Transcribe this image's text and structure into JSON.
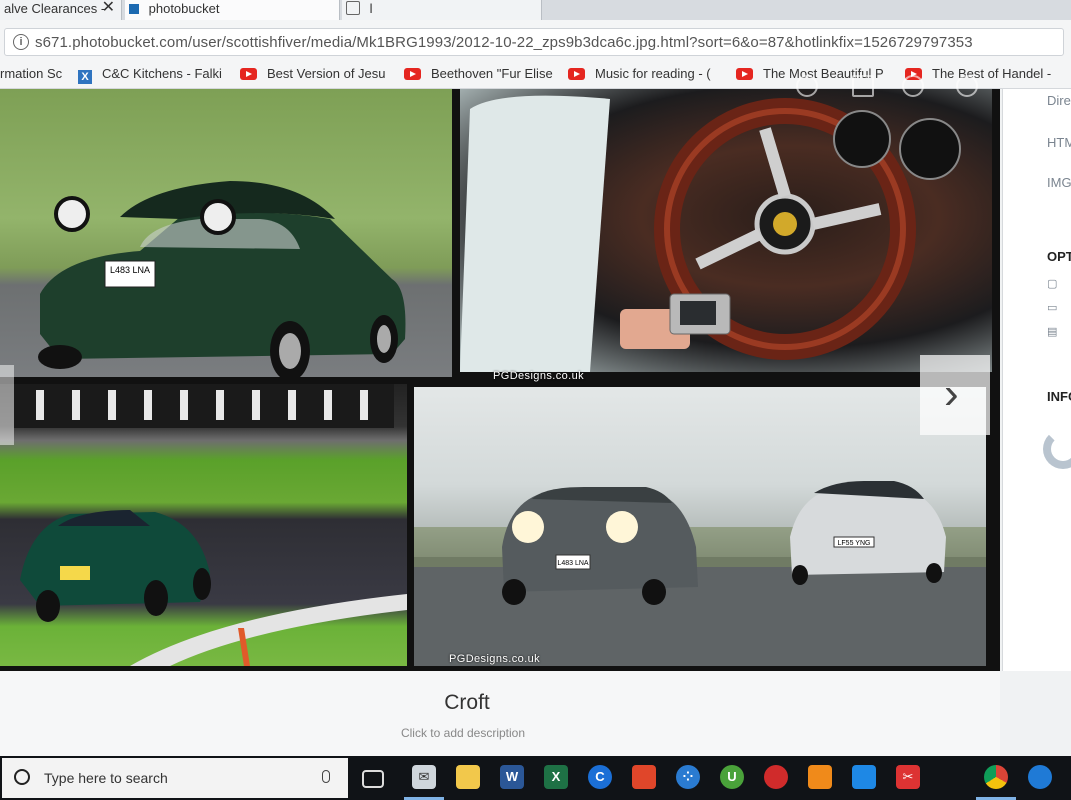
{
  "tabs": [
    {
      "label": "alve Clearances -",
      "close": "✕"
    },
    {
      "label": "photobucket"
    },
    {
      "label": "l"
    }
  ],
  "address": {
    "url": "s671.photobucket.com/user/scottishfiver/media/Mk1BRG1993/2012-10-22_zps9b3dca6c.jpg.html?sort=6&o=87&hotlinkfix=1526729797353"
  },
  "bookmarks": [
    {
      "label": "rmation Sc",
      "icon": "doc-icon"
    },
    {
      "label": "C&C Kitchens - Falki",
      "icon": "cc-icon"
    },
    {
      "label": "Best Version of Jesu",
      "icon": "youtube-icon"
    },
    {
      "label": "Beethoven \"Fur Elise",
      "icon": "youtube-icon"
    },
    {
      "label": "Music for reading - (",
      "icon": "youtube-icon"
    },
    {
      "label": "The Most Beautiful P",
      "icon": "youtube-icon"
    },
    {
      "label": "The Best of Handel -",
      "icon": "youtube-icon"
    }
  ],
  "photo": {
    "watermark_top": "PGDesigns.co.uk",
    "watermark_bottom": "PGDesigns.co.uk",
    "plate_green": "L483 LNA",
    "plate_silver": "LF55 YNG",
    "next_arrow": "›"
  },
  "side": {
    "links": [
      "Dire",
      "HTM",
      "IMG"
    ],
    "options_head": "OPT",
    "info_head": "INFO"
  },
  "caption": {
    "title": "Croft",
    "description": "Click to add description"
  },
  "taskbar": {
    "search_placeholder": "Type here to search",
    "apps": [
      "task-view",
      "mail",
      "file-explorer",
      "word",
      "excel",
      "refresh-app",
      "paint",
      "dots-app",
      "utorrent",
      "security-app",
      "avast",
      "outlook-app",
      "snipping",
      "chrome",
      "ie-app"
    ]
  },
  "colors": {
    "youtube_red": "#e52620",
    "taskbar_bg": "#101317",
    "page_bg": "#f0f2f3"
  }
}
